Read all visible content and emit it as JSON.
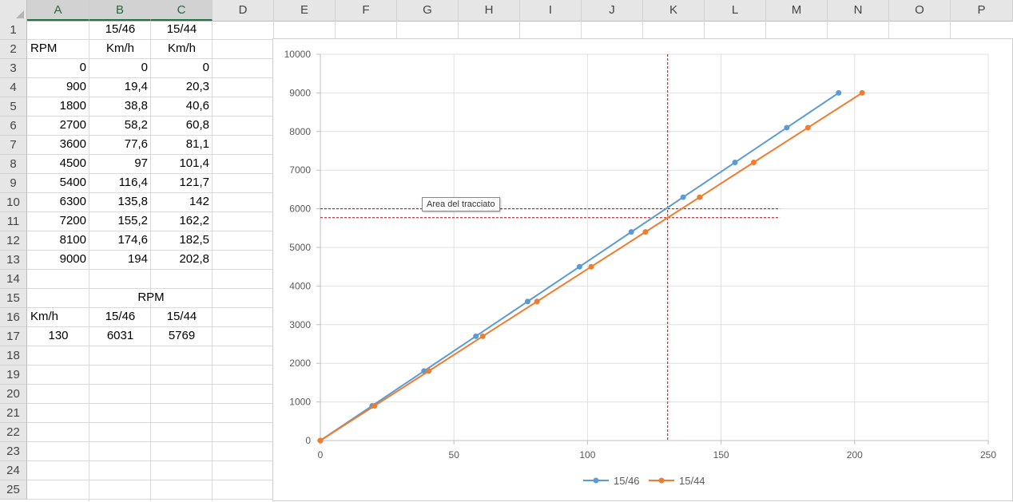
{
  "columns": [
    "A",
    "B",
    "C",
    "D",
    "E",
    "F",
    "G",
    "H",
    "I",
    "J",
    "K",
    "L",
    "M",
    "N",
    "O",
    "P"
  ],
  "rows": [
    "1",
    "2",
    "3",
    "4",
    "5",
    "6",
    "7",
    "8",
    "9",
    "10",
    "11",
    "12",
    "13",
    "14",
    "15",
    "16",
    "17",
    "18",
    "19",
    "20",
    "21",
    "22",
    "23",
    "24",
    "25"
  ],
  "cells": {
    "B1": "15/46",
    "C1": "15/44",
    "A2": "RPM",
    "B2": "Km/h",
    "C2": "Km/h",
    "A3": "0",
    "B3": "0",
    "C3": "0",
    "A4": "900",
    "B4": "19,4",
    "C4": "20,3",
    "A5": "1800",
    "B5": "38,8",
    "C5": "40,6",
    "A6": "2700",
    "B6": "58,2",
    "C6": "60,8",
    "A7": "3600",
    "B7": "77,6",
    "C7": "81,1",
    "A8": "4500",
    "B8": "97",
    "C8": "101,4",
    "A9": "5400",
    "B9": "116,4",
    "C9": "121,7",
    "A10": "6300",
    "B10": "135,8",
    "C10": "142",
    "A11": "7200",
    "B11": "155,2",
    "C11": "162,2",
    "A12": "8100",
    "B12": "174,6",
    "C12": "182,5",
    "A13": "9000",
    "B13": "194",
    "C13": "202,8",
    "B15": "RPM",
    "A16": "Km/h",
    "B16": "15/46",
    "C16": "15/44",
    "A17": "130",
    "B17": "6031",
    "C17": "5769"
  },
  "chart_tooltip": "Area del tracciato",
  "chart_data": {
    "type": "scatter",
    "xlim": [
      0,
      250
    ],
    "ylim": [
      0,
      10000
    ],
    "xticks": [
      0,
      50,
      100,
      150,
      200,
      250
    ],
    "yticks": [
      0,
      1000,
      2000,
      3000,
      4000,
      5000,
      6000,
      7000,
      8000,
      9000,
      10000
    ],
    "grid": true,
    "legend": "bottom",
    "series": [
      {
        "name": "15/46",
        "color": "#5b9bd5",
        "x": [
          0,
          19.4,
          38.8,
          58.2,
          77.6,
          97,
          116.4,
          135.8,
          155.2,
          174.6,
          194
        ],
        "y": [
          0,
          900,
          1800,
          2700,
          3600,
          4500,
          5400,
          6300,
          7200,
          8100,
          9000
        ]
      },
      {
        "name": "15/44",
        "color": "#ed7d31",
        "x": [
          0,
          20.3,
          40.6,
          60.8,
          81.1,
          101.4,
          121.7,
          142,
          162.2,
          182.5,
          202.8
        ],
        "y": [
          0,
          900,
          1800,
          2700,
          3600,
          4500,
          5400,
          6300,
          7200,
          8100,
          9000
        ]
      }
    ],
    "reference_lines": {
      "color": "#c00000",
      "vertical_x": 130,
      "horizontal_y": [
        6000,
        5769
      ]
    }
  }
}
